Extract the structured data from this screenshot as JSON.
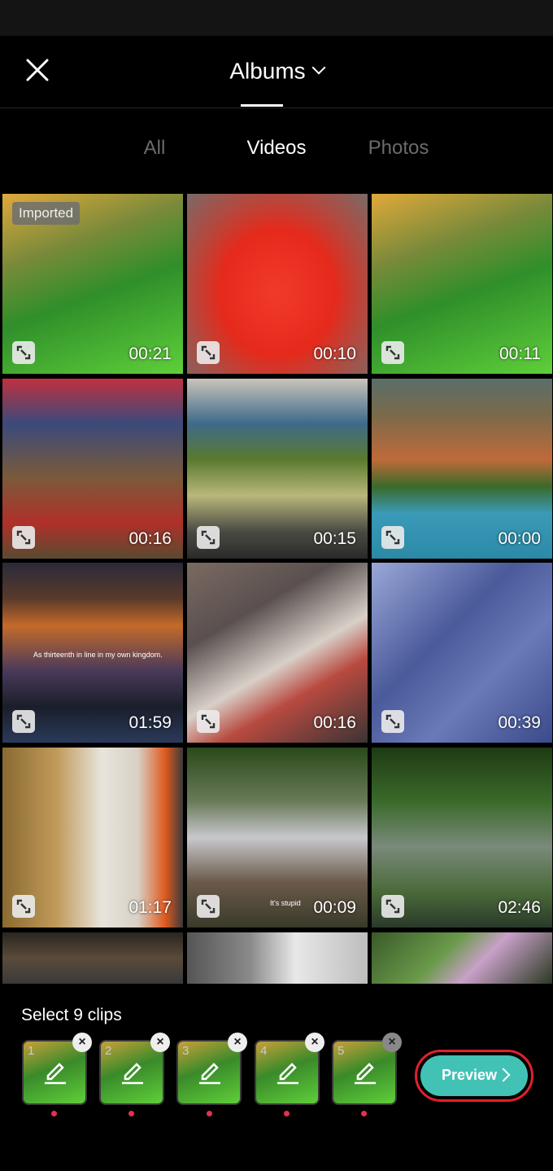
{
  "header": {
    "title": "Albums",
    "close_icon": "close-icon",
    "dropdown_icon": "chevron-down-icon"
  },
  "tabs": [
    {
      "label": "All",
      "active": false
    },
    {
      "label": "Videos",
      "active": true
    },
    {
      "label": "Photos",
      "active": false
    }
  ],
  "grid": {
    "items": [
      {
        "duration": "00:21",
        "badge": "Imported",
        "theme": "your-video-green"
      },
      {
        "duration": "00:10",
        "theme": "red-shirt"
      },
      {
        "duration": "00:11",
        "theme": "your-video-green"
      },
      {
        "duration": "00:16",
        "theme": "market-boy"
      },
      {
        "duration": "00:15",
        "theme": "minecraft"
      },
      {
        "duration": "00:00",
        "theme": "lakehouse"
      },
      {
        "duration": "01:59",
        "theme": "frozen-anna",
        "caption": "As thirteenth in line in my own kingdom."
      },
      {
        "duration": "00:16",
        "theme": "tablet"
      },
      {
        "duration": "00:39",
        "theme": "blue-pattern"
      },
      {
        "duration": "01:17",
        "theme": "worker-room"
      },
      {
        "duration": "00:09",
        "theme": "grandma-boy",
        "caption": "It's stupid"
      },
      {
        "duration": "02:46",
        "theme": "garden"
      },
      {
        "duration": "",
        "theme": "dark-hall"
      },
      {
        "duration": "",
        "theme": "bw-hands"
      },
      {
        "duration": "",
        "theme": "leaves-flowers"
      }
    ]
  },
  "selection": {
    "label": "Select 9 clips",
    "clips": [
      {
        "number": "1"
      },
      {
        "number": "2"
      },
      {
        "number": "3"
      },
      {
        "number": "4"
      },
      {
        "number": "5"
      }
    ],
    "remove_symbol": "×",
    "preview_label": "Preview"
  },
  "colors": {
    "accent": "#42c2b4",
    "highlight_ring": "#e0202e",
    "dot": "#e53050"
  }
}
